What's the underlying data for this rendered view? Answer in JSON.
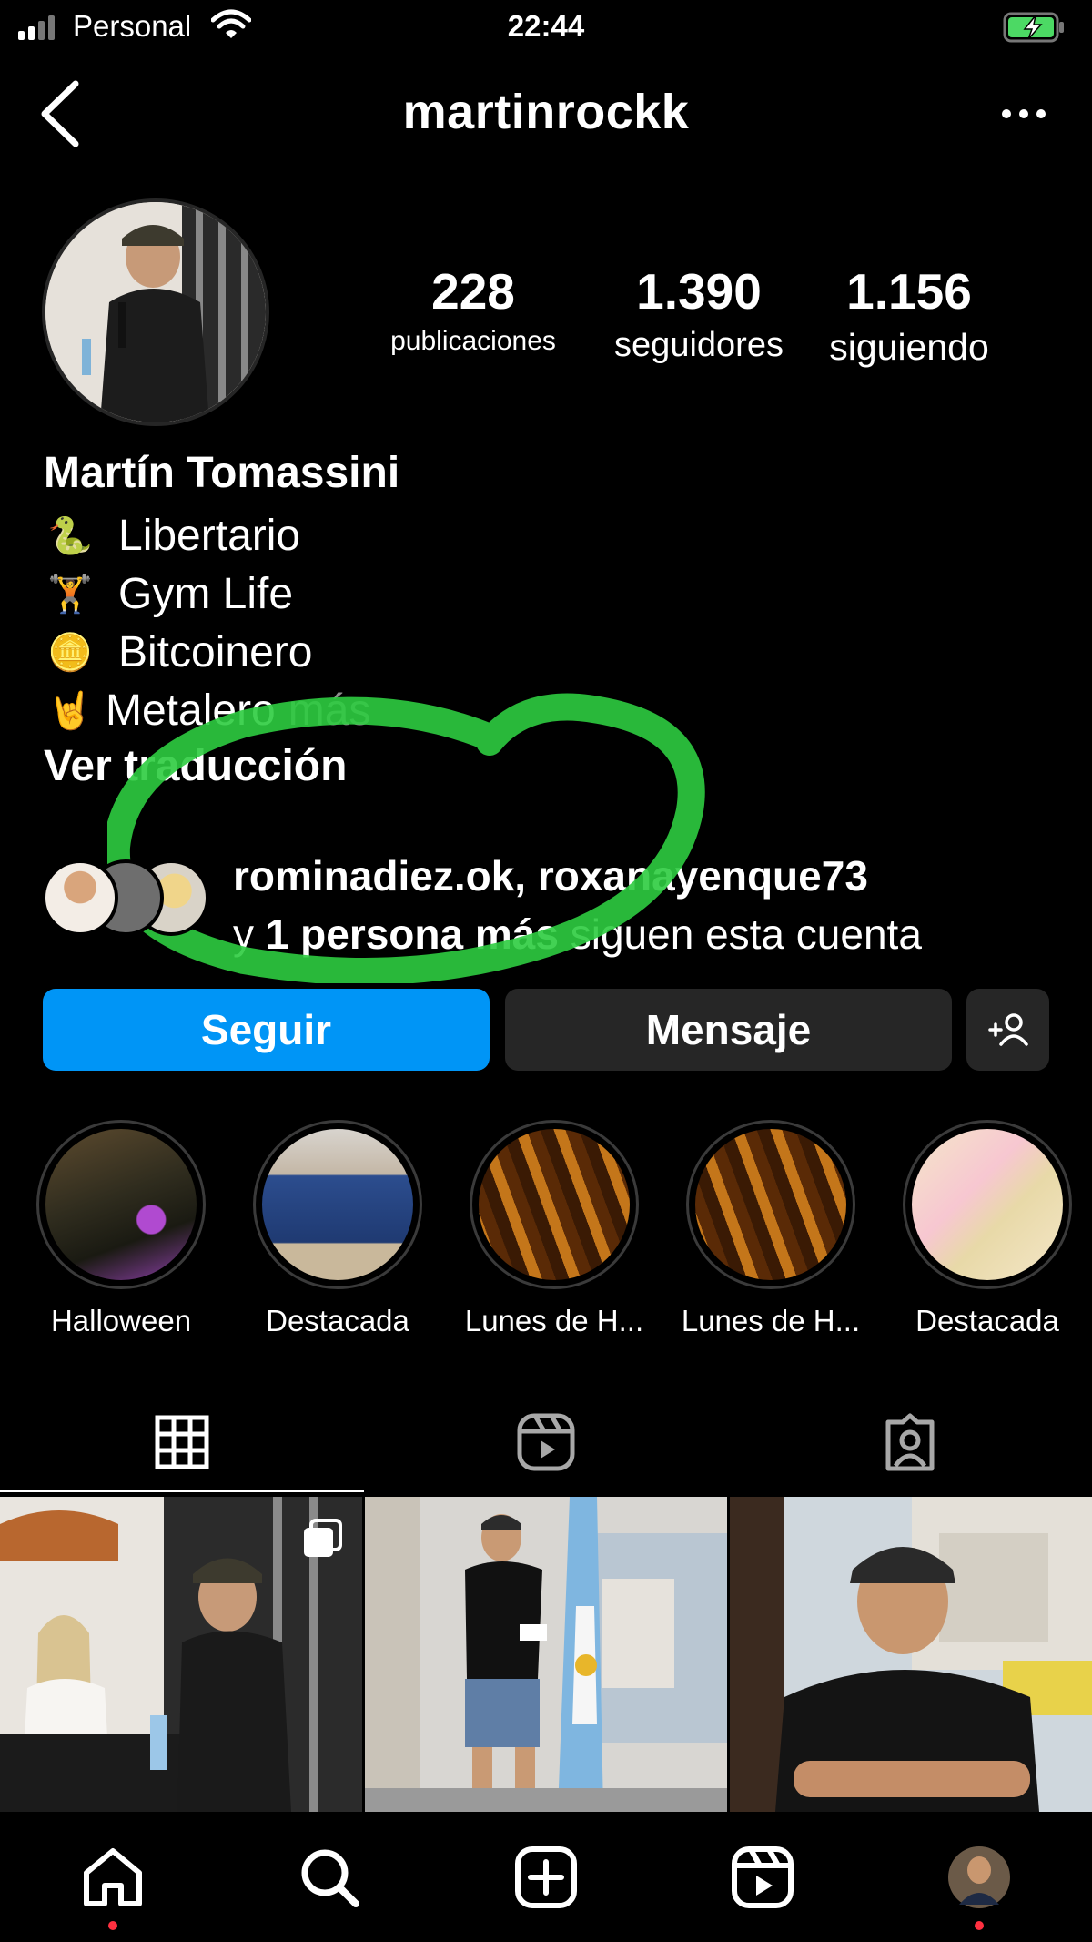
{
  "status_bar": {
    "carrier": "Personal",
    "time": "22:44",
    "icons": [
      "signal-icon",
      "wifi-icon",
      "battery-charging-icon"
    ],
    "battery_color": "#4cd964"
  },
  "header": {
    "username": "martinrockk",
    "icons": [
      "back-arrow-icon",
      "more-options-icon"
    ]
  },
  "profile": {
    "stats": [
      {
        "value": "228",
        "label": "publicaciones"
      },
      {
        "value": "1.390",
        "label": "seguidores"
      },
      {
        "value": "1.156",
        "label": "siguiendo"
      }
    ],
    "full_name": "Martín Tomassini",
    "bio_lines": [
      {
        "emoji": "🐍",
        "text": "Libertario"
      },
      {
        "emoji": "🏋",
        "text": "Gym Life"
      },
      {
        "emoji": "🪙",
        "text": "Bitcoinero"
      },
      {
        "emoji": "🤘",
        "text": "Metalero"
      }
    ],
    "more_label": "más",
    "translate_label": "Ver traducción"
  },
  "followed_by": {
    "names": "rominadiez.ok, roxanayenque73",
    "prefix": "y",
    "bold_part": "1 persona más",
    "suffix": "siguen esta cuenta"
  },
  "annotation": {
    "color": "#2ecc40"
  },
  "actions": {
    "follow_label": "Seguir",
    "message_label": "Mensaje",
    "add_user_icon": "add-user-icon",
    "accent": "#0095f6"
  },
  "highlights": [
    {
      "label": "Halloween"
    },
    {
      "label": "Destacada"
    },
    {
      "label": "Lunes de H..."
    },
    {
      "label": "Lunes de H..."
    },
    {
      "label": "Destacada"
    }
  ],
  "tabs": [
    {
      "name": "grid-icon",
      "active": true
    },
    {
      "name": "reels-icon",
      "active": false
    },
    {
      "name": "tagged-icon",
      "active": false
    }
  ],
  "bottom_nav": [
    "home-icon",
    "search-icon",
    "create-icon",
    "reels-icon",
    "profile-avatar"
  ]
}
